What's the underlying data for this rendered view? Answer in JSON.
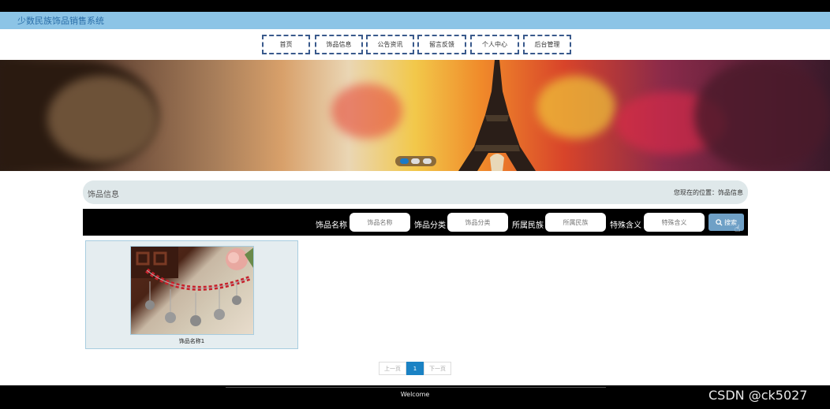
{
  "app": {
    "title": "少数民族饰品销售系统"
  },
  "nav": [
    "首页",
    "饰品信息",
    "公告资讯",
    "留言反馈",
    "个人中心",
    "后台管理"
  ],
  "section": {
    "title": "饰品信息",
    "breadcrumb": "您现在的位置：饰品信息"
  },
  "search": {
    "fields": [
      {
        "label": "饰品名称",
        "placeholder": "饰品名称"
      },
      {
        "label": "饰品分类",
        "placeholder": "饰品分类"
      },
      {
        "label": "所属民族",
        "placeholder": "所属民族"
      },
      {
        "label": "特殊含义",
        "placeholder": "特殊含义"
      }
    ],
    "button": "搜索"
  },
  "products": [
    {
      "name": "饰品名称1"
    }
  ],
  "pagination": {
    "prev": "上一页",
    "current": "1",
    "next": "下一页"
  },
  "footer": {
    "text": "Welcome"
  },
  "watermark": "CSDN @ck5027",
  "colors": {
    "titlebar": "#8cc4e6",
    "nav_border": "#3a5a8c",
    "active_page": "#1a82c4",
    "search_button": "#6fa0c6"
  }
}
